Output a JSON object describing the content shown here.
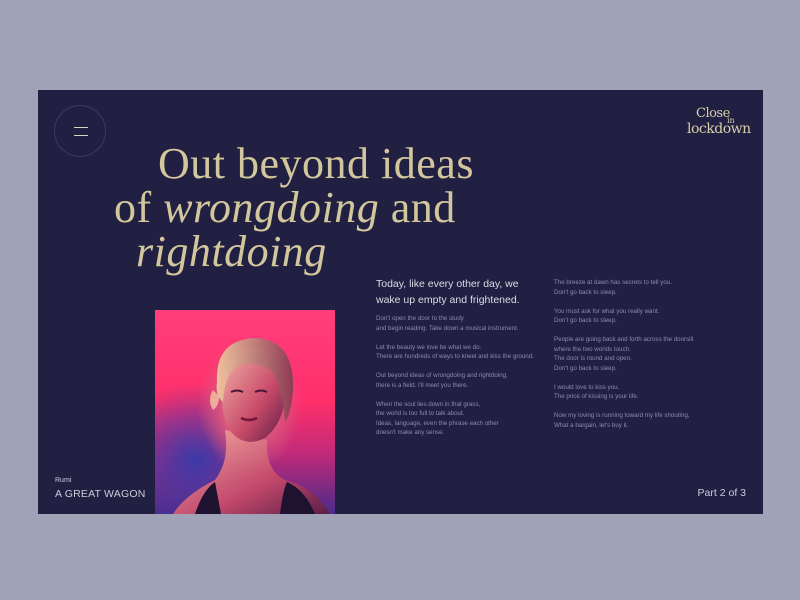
{
  "logo": {
    "word1": "Close",
    "word2": "in",
    "word3": "lockdown"
  },
  "headline": {
    "line1": "Out beyond ideas",
    "line2_prefix": "of ",
    "line2_em": "wrongdoing",
    "line2_suffix": " and",
    "line3_em": "rightdoing"
  },
  "intro": "Today, like every other day, we wake up empty and frightened.",
  "poem_left": [
    [
      "Don't open the door to the study",
      "and begin reading. Take down a musical instrument."
    ],
    [
      "Let the beauty we love be what we do.",
      "There are hundreds of ways to kneel and kiss the ground."
    ],
    [
      "Out beyond ideas of wrongdoing and rightdoing,",
      "there is a field. I'll meet you there."
    ],
    [
      "When the soul lies down in that grass,",
      "the world is too full to talk about.",
      "Ideas, language, even the phrase each other",
      "doesn't make any sense."
    ]
  ],
  "poem_right": [
    [
      "The breeze at dawn has secrets to tell you.",
      "Don't go back to sleep."
    ],
    [
      "You must ask for what you really want.",
      "Don't go back to sleep."
    ],
    [
      "People are going back and forth across the doorsill",
      "where the two worlds touch.",
      "The door is round and open.",
      "Don't go back to sleep."
    ],
    [
      "I would love to kiss you.",
      "The price of kissing is your life."
    ],
    [
      "Now my loving is running toward my life shouting,",
      "What a bargain, let's buy it."
    ]
  ],
  "author": {
    "name": "Rumi",
    "title": "A GREAT WAGON"
  },
  "pager": "Part 2 of 3",
  "colors": {
    "page_bg": "#a0a3b8",
    "panel_bg": "#211f42",
    "accent_gold": "#d2c79c",
    "photo_pink": "#ff3f7b"
  },
  "icons": {
    "menu": "hamburger-icon"
  }
}
